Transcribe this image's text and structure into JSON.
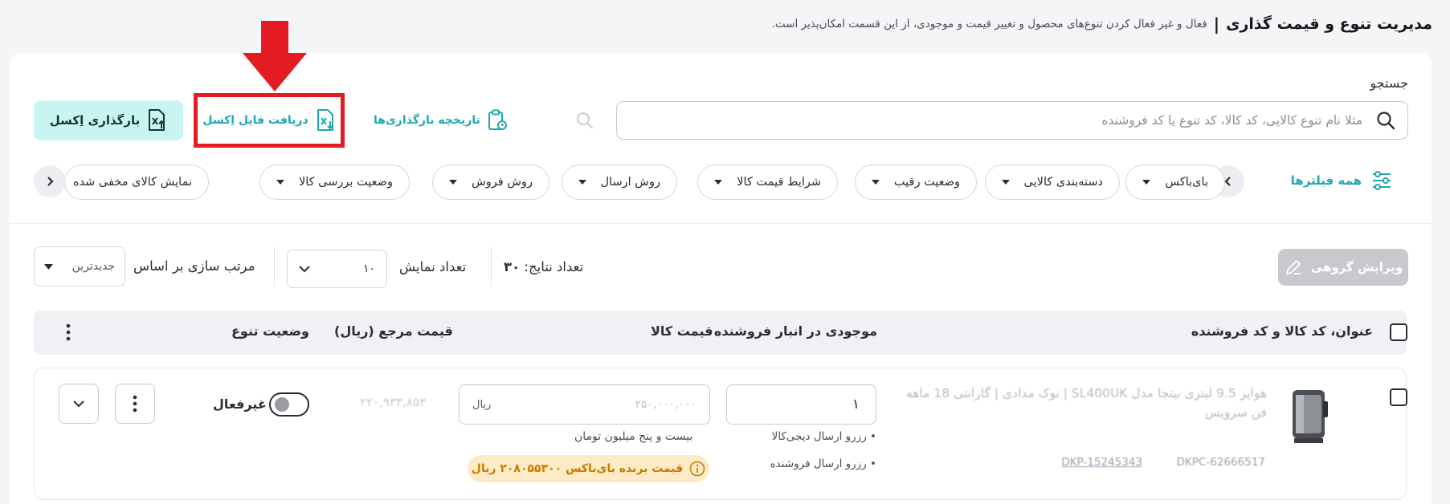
{
  "header": {
    "title": "مدیریت تنوع و قیمت گذاری",
    "separator": "|",
    "description": "فعال و غیر فعال کردن تنوع‌های محصول و تغییر قیمت و موجودی، از این قسمت امکان‌پذیر است."
  },
  "search": {
    "label": "جستجو",
    "placeholder": "مثلا نام تنوع کالایی، کد کالا، کد تنوع یا کد فروشنده",
    "value": ""
  },
  "actions": {
    "upload_history": "تاریخچه بارگذاری‌ها",
    "download_excel": "دریافت فایل اِکسل",
    "upload_excel": "بارگذاری اِکسل"
  },
  "filters": {
    "all_filters": "همه فیلترها",
    "chips": [
      "بای‌باکس",
      "دسته‌بندی کالایی",
      "وضعیت رقیب",
      "شرایط قیمت کالا",
      "روش ارسال",
      "روش فروش",
      "وضعیت بررسی کالا",
      "نمایش کالای مخفی شده"
    ]
  },
  "toolbar": {
    "bulk_edit": "ویرایش گروهی",
    "results_label": "تعداد نتایج:",
    "results_count": "۳۰",
    "show_count_label": "تعداد نمایش",
    "show_count_value": "۱۰",
    "sort_label": "مرتب سازی بر اساس",
    "sort_value": "جدیدترین"
  },
  "table": {
    "headers": {
      "title": "عنوان، کد کالا و کد فروشنده",
      "stock": "موجودی در انبار فروشنده",
      "price": "قیمت کالا",
      "ref_price": "قیمت مرجع (ریال)",
      "status": "وضعیت تنوع"
    },
    "rows": [
      {
        "title": "هواپز 9.5 لیتری بیتجا مدل SL400UK | نوک مدادی | گارانتی 18 ماهه فن سرویس",
        "dkp": "DKP-15245343",
        "dkpc": "DKPC-62666517",
        "stock": "۱",
        "reserve_digikala": "• رزرو ارسال دیجی‌کالا",
        "reserve_seller": "• رزرو ارسال فروشنده",
        "price": "۲۵۰,۰۰۰,۰۰۰",
        "price_unit": "ریال",
        "price_words": "بیست و پنج میلیون تومان",
        "buybox_badge": "قیمت برنده بای‌باکس ۲۰۸۰۵۵۳۰۰ ریال",
        "ref_price": "۲۲۰,۹۳۳,۸۵۳",
        "status": "غیرفعال",
        "status_on": false
      }
    ]
  },
  "colors": {
    "accent": "#1fa7b4",
    "annotation_red": "#e31b23",
    "upload_bg": "#c8f5f1",
    "badge_bg": "#fdebc5",
    "badge_text": "#c77c00"
  }
}
